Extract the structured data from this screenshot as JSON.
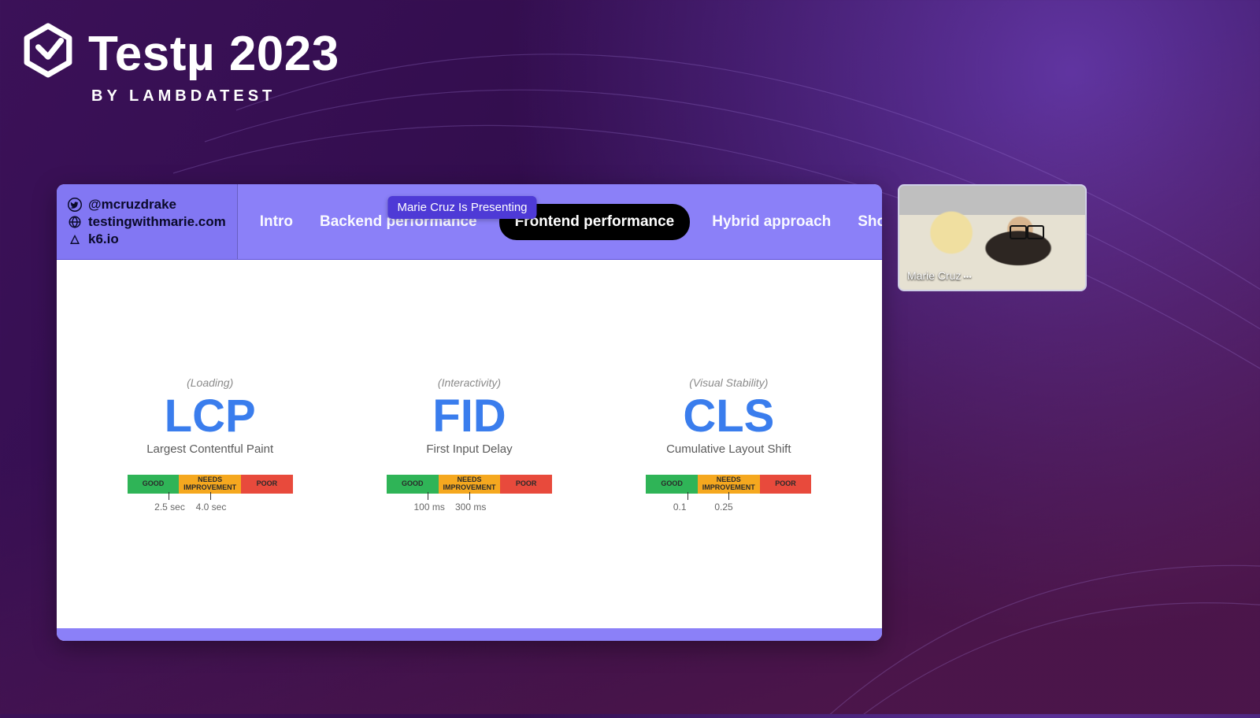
{
  "event": {
    "title": "Testµ 2023",
    "byline": "BY LAMBDATEST"
  },
  "badge": "Marie Cruz Is Presenting",
  "presenter_name": "Marie Cruz",
  "identity": {
    "handle": "@mcruzdrake",
    "site": "testingwithmarie.com",
    "org": "k6.io"
  },
  "nav": {
    "items": [
      "Intro",
      "Backend performance",
      "Frontend performance",
      "Hybrid approach",
      "Show me!"
    ],
    "active_index": 2
  },
  "segments": {
    "good": "GOOD",
    "warn": "NEEDS IMPROVEMENT",
    "poor": "POOR"
  },
  "metrics": [
    {
      "category": "(Loading)",
      "abbr": "LCP",
      "name": "Largest Contentful Paint",
      "thresholds": [
        "2.5 sec",
        "4.0 sec"
      ]
    },
    {
      "category": "(Interactivity)",
      "abbr": "FID",
      "name": "First Input Delay",
      "thresholds": [
        "100 ms",
        "300 ms"
      ]
    },
    {
      "category": "(Visual Stability)",
      "abbr": "CLS",
      "name": "Cumulative Layout Shift",
      "thresholds": [
        "0.1",
        "0.25"
      ]
    }
  ]
}
